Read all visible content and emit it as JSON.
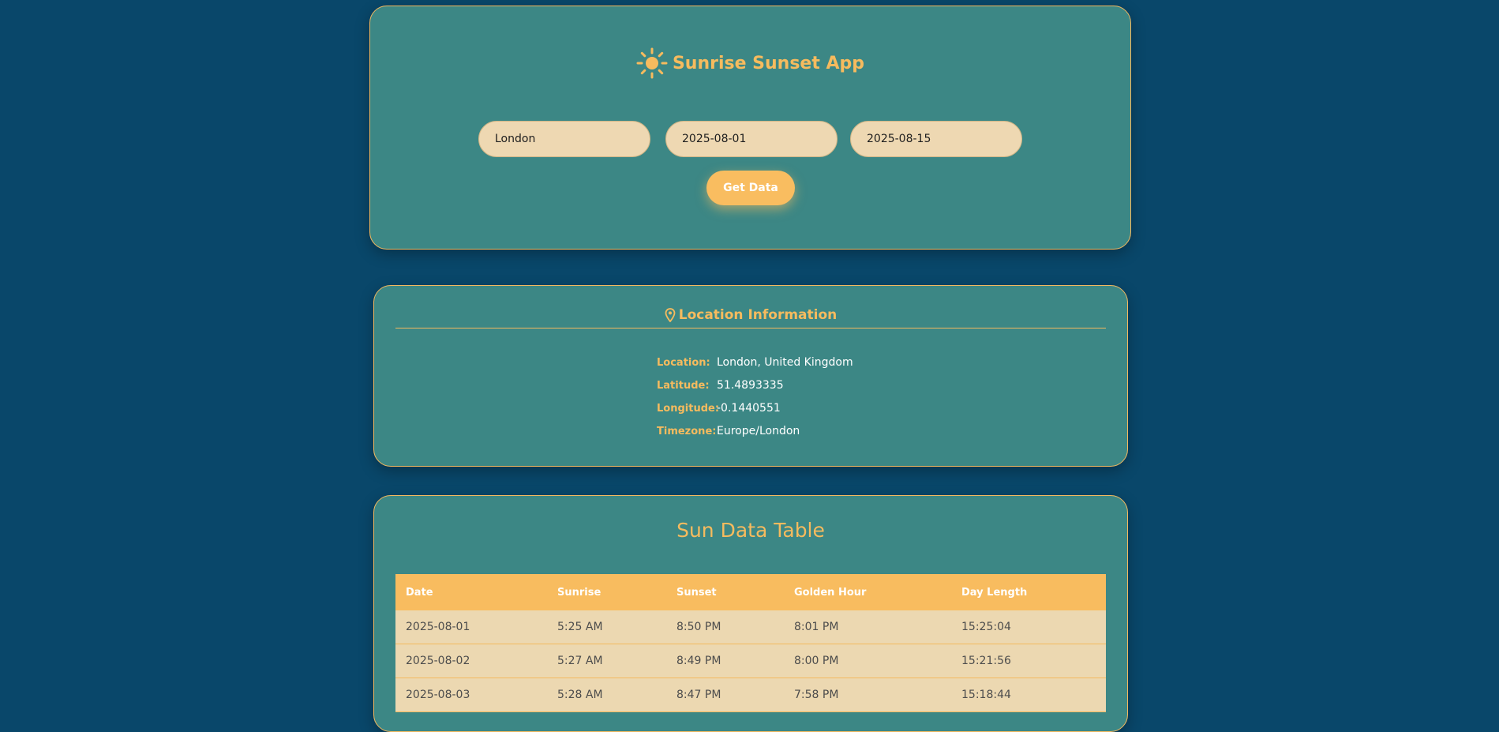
{
  "app": {
    "title": "Sunrise Sunset App",
    "accent_color": "#f9bd60",
    "background_color": "#09476a",
    "card_color": "#3c8785"
  },
  "search": {
    "city_value": "London",
    "start_date_value": "2025-08-01",
    "end_date_value": "2025-08-15",
    "submit_label": "Get Data"
  },
  "location": {
    "heading": "Location Information",
    "fields": [
      {
        "label": "Location:",
        "value": "London, United Kingdom"
      },
      {
        "label": "Latitude:",
        "value": "51.4893335"
      },
      {
        "label": "Longitude:",
        "value": "-0.1440551"
      },
      {
        "label": "Timezone:",
        "value": "Europe/London"
      }
    ]
  },
  "table": {
    "title": "Sun Data Table",
    "columns": [
      "Date",
      "Sunrise",
      "Sunset",
      "Golden Hour",
      "Day Length"
    ],
    "rows": [
      [
        "2025-08-01",
        "5:25 AM",
        "8:50 PM",
        "8:01 PM",
        "15:25:04"
      ],
      [
        "2025-08-02",
        "5:27 AM",
        "8:49 PM",
        "8:00 PM",
        "15:21:56"
      ],
      [
        "2025-08-03",
        "5:28 AM",
        "8:47 PM",
        "7:58 PM",
        "15:18:44"
      ]
    ]
  }
}
